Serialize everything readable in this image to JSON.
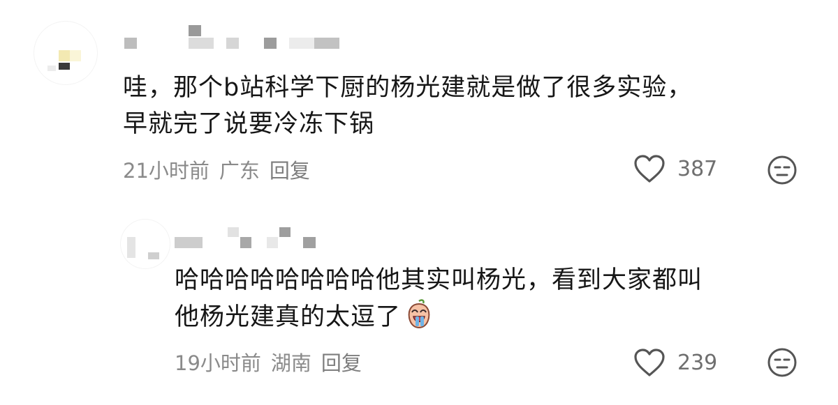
{
  "comments": [
    {
      "text_line1": "哇，那个b站科学下厨的杨光建就是做了很多实验，",
      "text_line2": "早就完了说要冷冻下锅",
      "time": "21小时前",
      "location": "广东",
      "reply_label": "回复",
      "likes": "387"
    },
    {
      "text_line1": "哈哈哈哈哈哈哈哈他其实叫杨光，看到大家都叫",
      "text_line2": "他杨光建真的太逗了",
      "time": "19小时前",
      "location": "湖南",
      "reply_label": "回复",
      "likes": "239"
    }
  ],
  "icons": {
    "like": "heart-outline-icon",
    "dislike": "unamused-face-icon",
    "inline_emoji": "laughing-peach-emoji"
  },
  "colors": {
    "text": "#161616",
    "meta": "#8a8a8a",
    "icon": "#555555"
  }
}
